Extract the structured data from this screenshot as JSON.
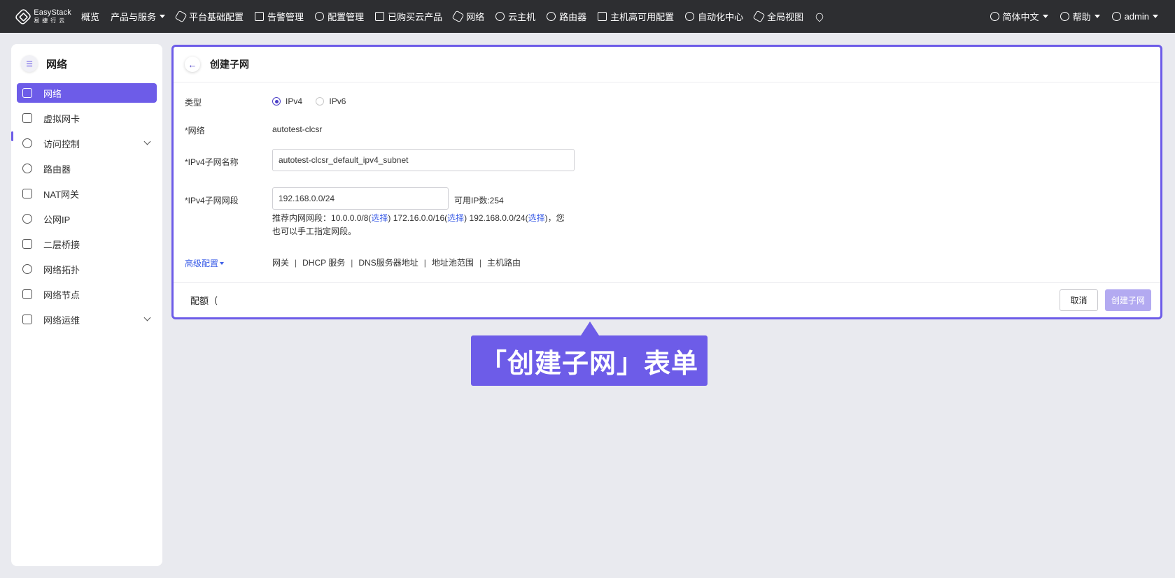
{
  "topbar": {
    "logo_en": "EasyStack",
    "logo_cn": "易捷行云",
    "nav_items": [
      {
        "label": "概览",
        "icon": "none"
      },
      {
        "label": "产品与服务",
        "icon": "none",
        "dropdown": true
      },
      {
        "label": "平台基础配置",
        "icon": "gear-icon"
      },
      {
        "label": "告警管理",
        "icon": "bell-icon"
      },
      {
        "label": "配置管理",
        "icon": "settings-icon"
      },
      {
        "label": "已购买云产品",
        "icon": "list-icon"
      },
      {
        "label": "网络",
        "icon": "network-icon"
      },
      {
        "label": "云主机",
        "icon": "cloud-icon"
      },
      {
        "label": "路由器",
        "icon": "router-icon"
      },
      {
        "label": "主机高可用配置",
        "icon": "ha-icon"
      },
      {
        "label": "自动化中心",
        "icon": "automation-icon"
      },
      {
        "label": "全局视图",
        "icon": "global-view-icon"
      }
    ],
    "language": "简体中文",
    "help": "帮助",
    "user": "admin"
  },
  "sidebar": {
    "title": "网络",
    "items": [
      {
        "label": "网络",
        "icon": "network-icon",
        "active": true
      },
      {
        "label": "虚拟网卡",
        "icon": "nic-icon"
      },
      {
        "label": "访问控制",
        "icon": "access-control-icon",
        "expandable": true
      },
      {
        "label": "路由器",
        "icon": "router-icon"
      },
      {
        "label": "NAT网关",
        "icon": "nat-gateway-icon"
      },
      {
        "label": "公网IP",
        "icon": "public-ip-icon"
      },
      {
        "label": "二层桥接",
        "icon": "bridge-icon"
      },
      {
        "label": "网络拓扑",
        "icon": "topology-icon"
      },
      {
        "label": "网络节点",
        "icon": "node-icon"
      },
      {
        "label": "网络运维",
        "icon": "ops-icon",
        "expandable": true
      }
    ]
  },
  "form": {
    "title": "创建子网",
    "type_label": "类型",
    "type_options": [
      "IPv4",
      "IPv6"
    ],
    "type_selected": "IPv4",
    "network_label": "*网络",
    "network_value": "autotest-clcsr",
    "subnet_name_label": "*IPv4子网名称",
    "subnet_name_value": "autotest-clcsr_default_ipv4_subnet",
    "cidr_label": "*IPv4子网网段",
    "cidr_value": "192.168.0.0/24",
    "available_ip": "可用IP数:254",
    "hint_prefix": "推荐内网网段：",
    "hint_seg1": "10.0.0.0/8(",
    "hint_seg2": "172.16.0.0/16(",
    "hint_seg3": "192.168.0.0/24(",
    "hint_close": ")",
    "choose": "选择",
    "hint_suffix": "，您也可以手工指定网段。",
    "advanced_label": "高级配置",
    "advanced_items": [
      "网关",
      "DHCP 服务",
      "DNS服务器地址",
      "地址池范围",
      "主机路由"
    ],
    "quota_label": "配额（",
    "cancel_label": "取消",
    "create_label": "创建子网"
  },
  "callout": {
    "text": "「创建子网」表单"
  },
  "colors": {
    "accent": "#6d5ce8",
    "link": "#3b5de7",
    "topbar": "#2d2e31",
    "background": "#e9eaef"
  }
}
